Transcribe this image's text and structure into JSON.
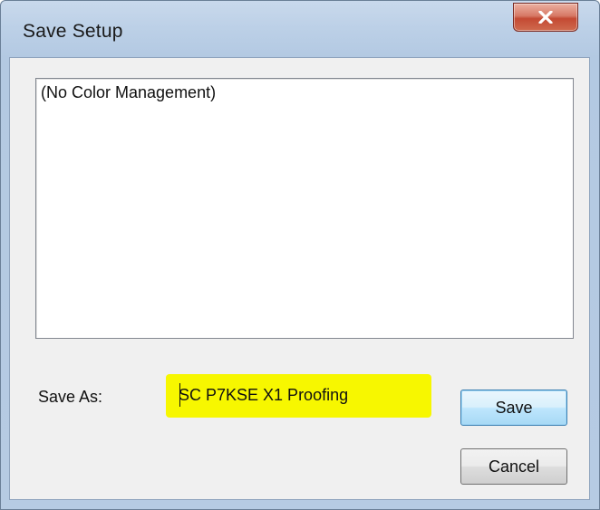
{
  "window": {
    "title": "Save Setup",
    "close_label": "x"
  },
  "setups_list": {
    "items": [
      "(No Color Management)"
    ]
  },
  "save_as": {
    "label": "Save As:",
    "value": "SC P7KSE X1 Proofing"
  },
  "buttons": {
    "save_label": "Save",
    "cancel_label": "Cancel"
  },
  "colors": {
    "highlight": "#f7f700",
    "close_button": "#c9523b",
    "frame": "#b6cbe3"
  },
  "icons": {
    "close": "close-icon"
  }
}
